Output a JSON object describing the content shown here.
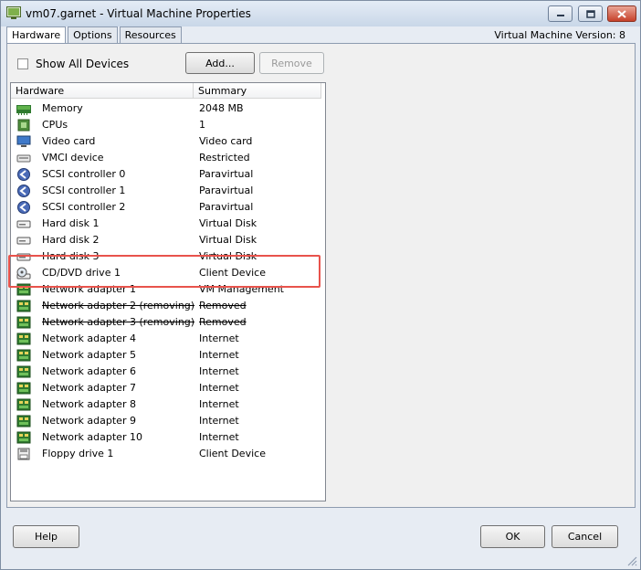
{
  "window": {
    "title": "vm07.garnet - Virtual Machine Properties",
    "version_label": "Virtual Machine Version: 8"
  },
  "tabs": [
    {
      "label": "Hardware",
      "active": true
    },
    {
      "label": "Options",
      "active": false
    },
    {
      "label": "Resources",
      "active": false
    }
  ],
  "toolbar": {
    "show_all_devices_label": "Show All Devices",
    "show_all_devices_checked": false,
    "add_label": "Add...",
    "remove_label": "Remove"
  },
  "table": {
    "headers": [
      "Hardware",
      "Summary"
    ],
    "rows": [
      {
        "icon": "memory-icon",
        "name": "Memory",
        "summary": "2048 MB",
        "removing": false
      },
      {
        "icon": "cpu-icon",
        "name": "CPUs",
        "summary": "1",
        "removing": false
      },
      {
        "icon": "video-card-icon",
        "name": "Video card",
        "summary": "Video card",
        "removing": false
      },
      {
        "icon": "vmci-device-icon",
        "name": "VMCI device",
        "summary": "Restricted",
        "removing": false
      },
      {
        "icon": "scsi-controller-icon",
        "name": "SCSI controller 0",
        "summary": "Paravirtual",
        "removing": false
      },
      {
        "icon": "scsi-controller-icon",
        "name": "SCSI controller 1",
        "summary": "Paravirtual",
        "removing": false
      },
      {
        "icon": "scsi-controller-icon",
        "name": "SCSI controller 2",
        "summary": "Paravirtual",
        "removing": false
      },
      {
        "icon": "hard-disk-icon",
        "name": "Hard disk 1",
        "summary": "Virtual Disk",
        "removing": false
      },
      {
        "icon": "hard-disk-icon",
        "name": "Hard disk 2",
        "summary": "Virtual Disk",
        "removing": false
      },
      {
        "icon": "hard-disk-icon",
        "name": "Hard disk 3",
        "summary": "Virtual Disk",
        "removing": false
      },
      {
        "icon": "cd-dvd-drive-icon",
        "name": "CD/DVD drive 1",
        "summary": "Client Device",
        "removing": false
      },
      {
        "icon": "network-adapter-icon",
        "name": "Network adapter 1",
        "summary": "VM Management",
        "removing": false
      },
      {
        "icon": "network-adapter-icon",
        "name": "Network adapter 2 (removing)",
        "summary": "Removed",
        "removing": true
      },
      {
        "icon": "network-adapter-icon",
        "name": "Network adapter 3 (removing)",
        "summary": "Removed",
        "removing": true
      },
      {
        "icon": "network-adapter-icon",
        "name": "Network adapter 4",
        "summary": "Internet",
        "removing": false
      },
      {
        "icon": "network-adapter-icon",
        "name": "Network adapter 5",
        "summary": "Internet",
        "removing": false
      },
      {
        "icon": "network-adapter-icon",
        "name": "Network adapter 6",
        "summary": "Internet",
        "removing": false
      },
      {
        "icon": "network-adapter-icon",
        "name": "Network adapter 7",
        "summary": "Internet",
        "removing": false
      },
      {
        "icon": "network-adapter-icon",
        "name": "Network adapter 8",
        "summary": "Internet",
        "removing": false
      },
      {
        "icon": "network-adapter-icon",
        "name": "Network adapter 9",
        "summary": "Internet",
        "removing": false
      },
      {
        "icon": "network-adapter-icon",
        "name": "Network adapter 10",
        "summary": "Internet",
        "removing": false
      },
      {
        "icon": "floppy-drive-icon",
        "name": "Floppy drive 1",
        "summary": "Client Device",
        "removing": false
      }
    ]
  },
  "footer": {
    "help_label": "Help",
    "ok_label": "OK",
    "cancel_label": "Cancel"
  },
  "colors": {
    "highlight": "#e8534c",
    "titlebar": "#c9d7e8"
  }
}
